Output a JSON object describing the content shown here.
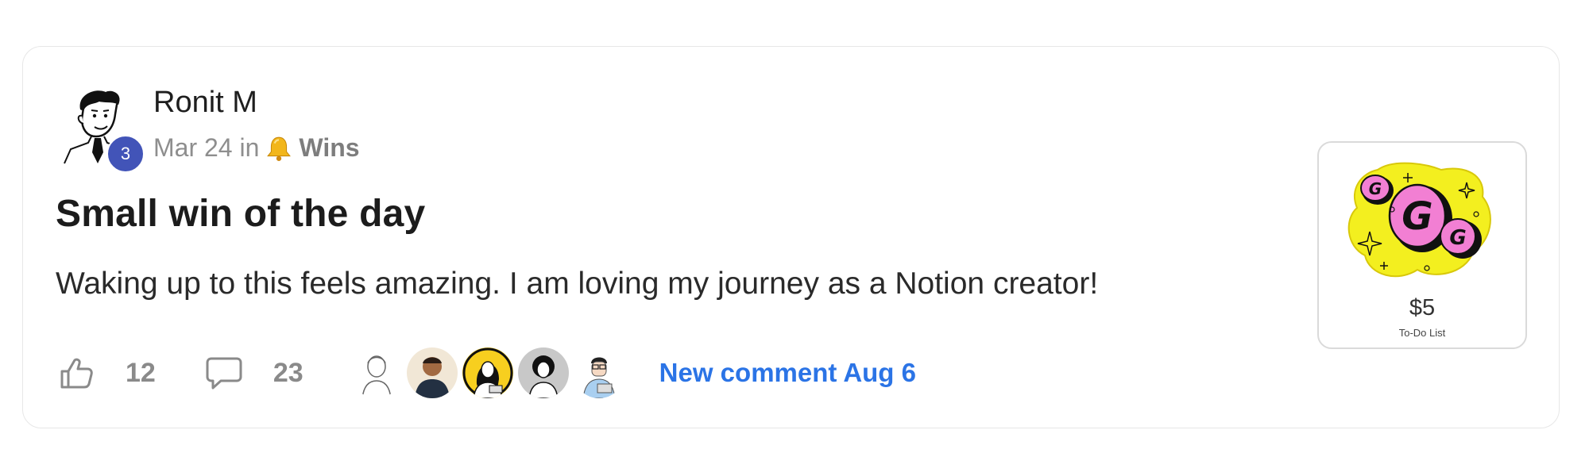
{
  "post": {
    "author": {
      "name": "Ronit M",
      "level": "3",
      "avatar_icon": "cartoon-avatar-icon"
    },
    "meta": {
      "date_prefix": "Mar 24 in",
      "category_icon": "bell-icon",
      "category": "Wins"
    },
    "title": "Small win of the day",
    "body": "Waking up to this feels amazing. I am loving my journey as a Notion creator!",
    "actions": {
      "likes": "12",
      "comments": "23",
      "new_comment": "New comment Aug 6"
    }
  },
  "product": {
    "price": "$5",
    "name": "To-Do List"
  },
  "colors": {
    "accent_link": "#2b74e6",
    "level_badge": "#4254b8",
    "product_bg": "#f3ef1f",
    "product_coin": "#f27fd3"
  }
}
